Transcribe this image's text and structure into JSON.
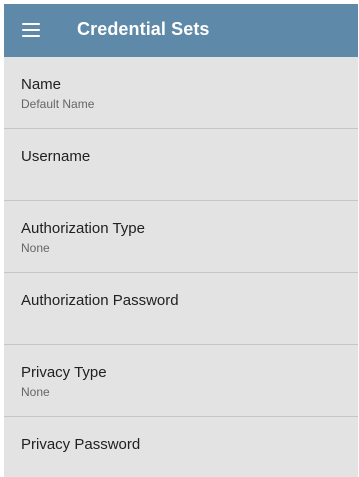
{
  "appbar": {
    "title": "Credential Sets",
    "menu_icon": "hamburger-menu-icon",
    "color": "#5e89a8"
  },
  "fields": [
    {
      "label": "Name",
      "value": "Default Name"
    },
    {
      "label": "Username",
      "value": ""
    },
    {
      "label": "Authorization Type",
      "value": "None"
    },
    {
      "label": "Authorization Password",
      "value": ""
    },
    {
      "label": "Privacy Type",
      "value": "None"
    },
    {
      "label": "Privacy Password",
      "value": ""
    }
  ]
}
